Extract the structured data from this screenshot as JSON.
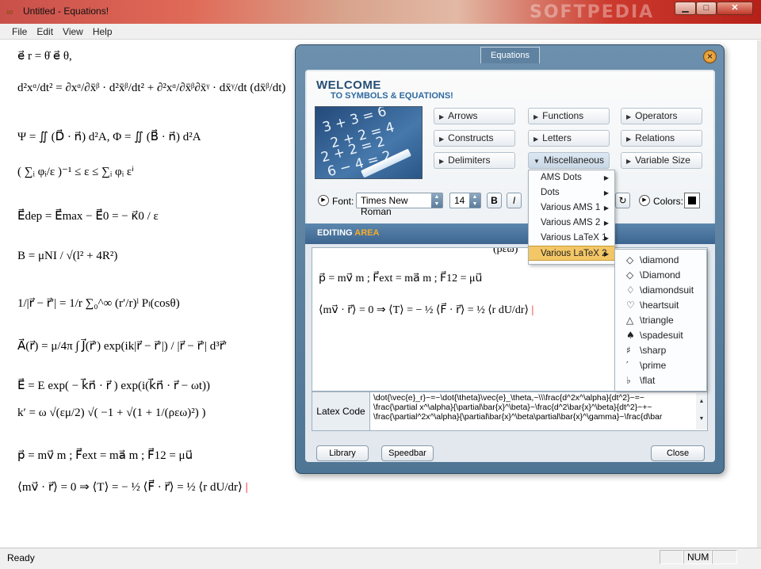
{
  "window": {
    "title": "Untitled - Equations!",
    "watermark": "SOFTPEDIA",
    "controls": {
      "minimize": "▁",
      "maximize": "□",
      "close": "✕"
    }
  },
  "menu": [
    "File",
    "Edit",
    "View",
    "Help"
  ],
  "document": {
    "equations": [
      "e⃗ r = θ̇ e⃗ θ,",
      "d²xᵅ/dt² = ∂xᵅ/∂x̄ᵝ · d²x̄ᵝ/dt² + ∂²xᵅ/∂x̄ᵝ∂x̄ᵞ · dx̄ᵞ/dt (dx̄ᵝ/dt)",
      "Ψ = ∬ (D⃗ · n⃗) d²A,   Φ = ∬ (B⃗ · n⃗) d²A",
      "( ∑ᵢ φᵢ/ε )⁻¹ ≤ ε ≤ ∑ᵢ φᵢ εⁱ",
      "E⃗dep = E⃗max − E⃗0 = − κ⃗0 / ε",
      "B = μNI / √(l² + 4R²)",
      "1/|r⃗ − r⃗′| = 1/r ∑₀^∞ (r′/r)ˡ Pₗ(cosθ)",
      "A⃗(r⃗) = μ/4π ∫ J⃗(r⃗′) exp(ik|r⃗ − r⃗′|) / |r⃗ − r⃗′| d³r⃗′",
      "E⃗ = E exp( − k⃗n⃗ · r⃗ ) exp(i(k⃗n⃗ · r⃗ − ωt))",
      "k′ = ω √(εμ/2) √( −1 + √(1 + 1/(ρεω)²) )",
      "p⃗ = mv⃗ m ;  F⃗ext = ma⃗ m ;  F⃗12 = μu⃗",
      "⟨mv⃗ · r⃗⟩ = 0 ⇒ ⟨T⟩ = − ½ ⟨F⃗ · r⃗⟩ = ½ ⟨r dU/dr⟩"
    ]
  },
  "status": {
    "text": "Ready",
    "num": "NUM"
  },
  "dialog": {
    "tab": "Equations",
    "welcome_title": "WELCOME",
    "welcome_subtitle": "TO SYMBOLS & EQUATIONS!",
    "chalk": [
      "3 + 3 = 6",
      "2 + 2 = 4",
      "2 + 2 = 2",
      "6 − 4 = 2"
    ],
    "categories": [
      "Arrows",
      "Functions",
      "Operators",
      "Constructs",
      "Letters",
      "Relations",
      "Delimiters",
      "Miscellaneous",
      "Variable Size"
    ],
    "font_label": "Font:",
    "font_value": "Times New Roman",
    "size_value": "14",
    "bold": "B",
    "italic": "I",
    "colors_label": "Colors:",
    "color_value": "#000000",
    "editing_prefix": "EDITING ",
    "editing_accent": "AREA",
    "edit_lines": [
      "p⃗ = mv⃗ m ;  F⃗ext = ma⃗ m ;  F⃗12 = μu⃗",
      "⟨mv⃗ · r⃗⟩ = 0 ⇒ ⟨T⟩ = − ½ ⟨F⃗ · r⃗⟩ = ½ ⟨r dU/dr⟩"
    ],
    "edit_cut_line": "(ρεω)",
    "latex_label": "Latex Code",
    "latex_code": "\\dot{\\vec{e}_r}~=~\\dot{\\theta}\\vec{e}_\\theta,~\\\\\\frac{d^2x^\\alpha}{dt^2}~=~\n\\frac{\\partial x^\\alpha}{\\partial\\bar{x}^\\beta}~\\frac{d^2\\bar{x}^\\beta}{dt^2}~+~\n\\frac{\\partial^2x^\\alpha}{\\partial\\bar{x}^\\beta\\partial\\bar{x}^\\gamma}~\\frac{d\\bar",
    "buttons": {
      "library": "Library",
      "speedbar": "Speedbar",
      "close": "Close"
    },
    "misc_menu": [
      "AMS Dots",
      "Dots",
      "Various AMS 1",
      "Various AMS 2",
      "Various LaTeX 1",
      "Various LaTeX 2"
    ],
    "misc_menu_highlight": "Various LaTeX 2",
    "symbol_menu": [
      {
        "glyph": "◇",
        "label": "\\diamond"
      },
      {
        "glyph": "◇",
        "label": "\\Diamond"
      },
      {
        "glyph": "♢",
        "label": "\\diamondsuit"
      },
      {
        "glyph": "♡",
        "label": "\\heartsuit"
      },
      {
        "glyph": "△",
        "label": "\\triangle"
      },
      {
        "glyph": "♠",
        "label": "\\spadesuit"
      },
      {
        "glyph": "♯",
        "label": "\\sharp"
      },
      {
        "glyph": "′",
        "label": "\\prime"
      },
      {
        "glyph": "♭",
        "label": "\\flat"
      }
    ]
  }
}
